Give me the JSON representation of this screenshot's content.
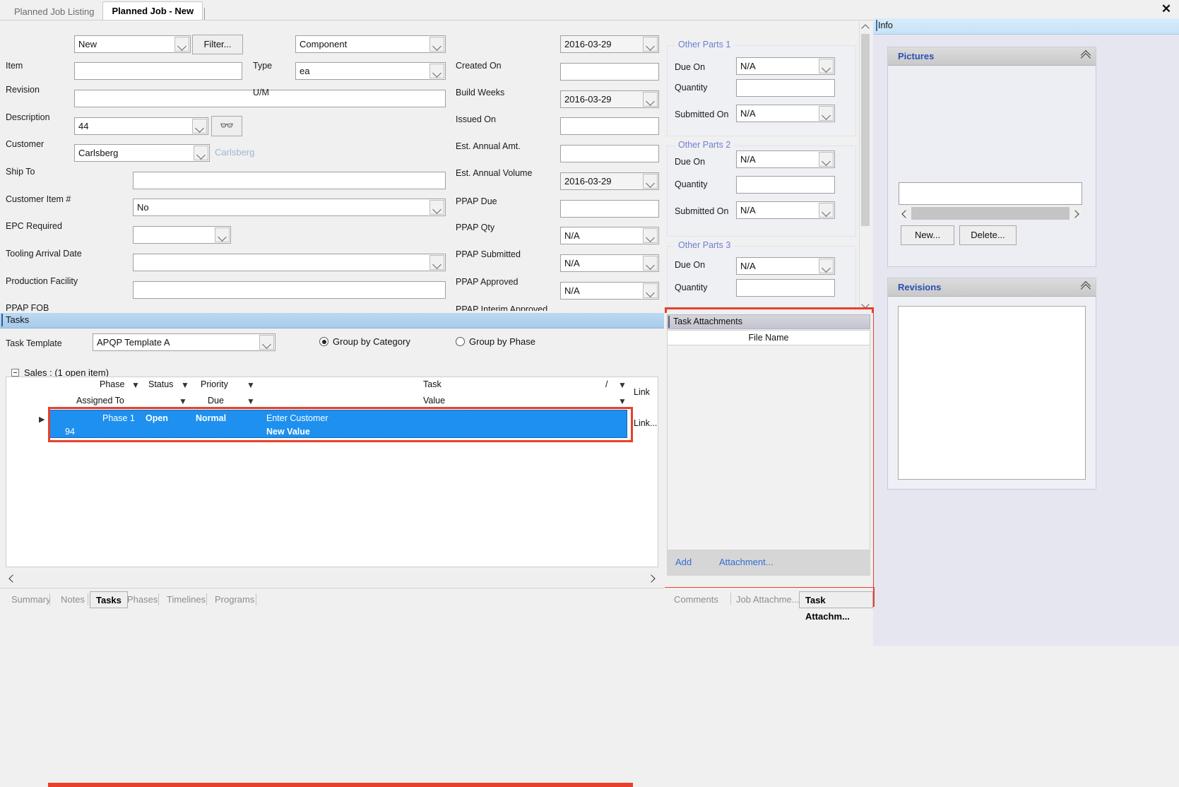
{
  "window": {
    "tabs": [
      {
        "label": "Planned Job Listing",
        "active": false
      },
      {
        "label": "Planned Job - New",
        "active": true
      }
    ],
    "close_label": "✕"
  },
  "form": {
    "left_column": [
      {
        "label": "Item",
        "value": "New",
        "type": "combo"
      },
      {
        "label": "Revision",
        "value": "",
        "type": "text"
      },
      {
        "label": "Description",
        "value": "",
        "type": "text"
      },
      {
        "label": "Customer",
        "value": "44",
        "type": "combo"
      },
      {
        "label": "Ship To",
        "value": "Carlsberg",
        "type": "combo"
      },
      {
        "label": "Customer Item #",
        "value": "",
        "type": "text"
      },
      {
        "label": "EPC Required",
        "value": "No",
        "type": "combo"
      },
      {
        "label": "Tooling Arrival Date",
        "value": "",
        "type": "combo"
      },
      {
        "label": "Production Facility",
        "value": "",
        "type": "combo"
      },
      {
        "label": "PPAP FOB",
        "value": "",
        "type": "text"
      }
    ],
    "filter_button": "Filter...",
    "customer_lookup_icon": "binoculars-icon",
    "ship_to_hint": "Carlsberg",
    "type_label": "Type",
    "type_value": "Component",
    "um_label": "U/M",
    "um_value": "ea",
    "middle_column": [
      {
        "label": "Created On",
        "value": "2016-03-29",
        "type": "combo"
      },
      {
        "label": "Build Weeks",
        "value": "",
        "type": "text"
      },
      {
        "label": "Issued On",
        "value": "2016-03-29",
        "type": "combo"
      },
      {
        "label": "Est. Annual Amt.",
        "value": "",
        "type": "text"
      },
      {
        "label": "Est. Annual Volume",
        "value": "",
        "type": "text"
      },
      {
        "label": "PPAP Due",
        "value": "2016-03-29",
        "type": "combo"
      },
      {
        "label": "PPAP Qty",
        "value": "",
        "type": "text"
      },
      {
        "label": "PPAP Submitted",
        "value": "N/A",
        "type": "combo"
      },
      {
        "label": "PPAP Approved",
        "value": "N/A",
        "type": "combo"
      },
      {
        "label": "PPAP Interim Approved",
        "value": "N/A",
        "type": "combo"
      }
    ],
    "other_parts": [
      {
        "title": "Other Parts 1",
        "fields": [
          {
            "label": "Due On",
            "value": "N/A",
            "type": "combo"
          },
          {
            "label": "Quantity",
            "value": "",
            "type": "text"
          },
          {
            "label": "Submitted On",
            "value": "N/A",
            "type": "combo"
          }
        ]
      },
      {
        "title": "Other Parts 2",
        "fields": [
          {
            "label": "Due On",
            "value": "N/A",
            "type": "combo"
          },
          {
            "label": "Quantity",
            "value": "",
            "type": "text"
          },
          {
            "label": "Submitted On",
            "value": "N/A",
            "type": "combo"
          }
        ]
      },
      {
        "title": "Other Parts 3",
        "fields": [
          {
            "label": "Due On",
            "value": "N/A",
            "type": "combo"
          },
          {
            "label": "Quantity",
            "value": "",
            "type": "text"
          }
        ]
      }
    ]
  },
  "info": {
    "title": "Info",
    "pictures": {
      "title": "Pictures",
      "field_value": "",
      "new_button": "New...",
      "delete_button": "Delete..."
    },
    "revisions": {
      "title": "Revisions"
    }
  },
  "tasks": {
    "title": "Tasks",
    "task_template_label": "Task Template",
    "task_template_value": "APQP Template A",
    "group_by_category": "Group by Category",
    "group_by_phase": "Group by Phase",
    "group_node": "Sales : (1 open item)",
    "columns_row1": [
      "Phase",
      "Status",
      "Priority",
      "Task",
      "/"
    ],
    "columns_row2": [
      "Assigned To",
      "Due",
      "Value"
    ],
    "link_header": "Link",
    "selected_row": {
      "phase": "Phase 1",
      "status": "Open",
      "priority": "Normal",
      "task": "Enter Customer",
      "assigned_to": "94",
      "due": "",
      "value": "New Value",
      "link": "Link..."
    },
    "bottom_tabs": [
      {
        "label": "Summary",
        "active": false
      },
      {
        "label": "Notes",
        "active": false
      },
      {
        "label": "Tasks",
        "active": true
      },
      {
        "label": "Phases",
        "active": false
      },
      {
        "label": "Timelines",
        "active": false
      },
      {
        "label": "Programs",
        "active": false
      }
    ]
  },
  "attachments": {
    "title": "Task Attachments",
    "file_name_header": "File Name",
    "add_link": "Add",
    "attachment_link": "Attachment...",
    "tabs": [
      {
        "label": "Comments",
        "active": false
      },
      {
        "label": "Job Attachme...",
        "active": false
      },
      {
        "label": "Task Attachm...",
        "active": true
      }
    ]
  },
  "colors": {
    "accent_blue": "#1e90ef",
    "highlight_red": "#e8402a",
    "group_title": "#6a7fd8",
    "card_title": "#2a4fb0",
    "link": "#2f6fd0"
  }
}
